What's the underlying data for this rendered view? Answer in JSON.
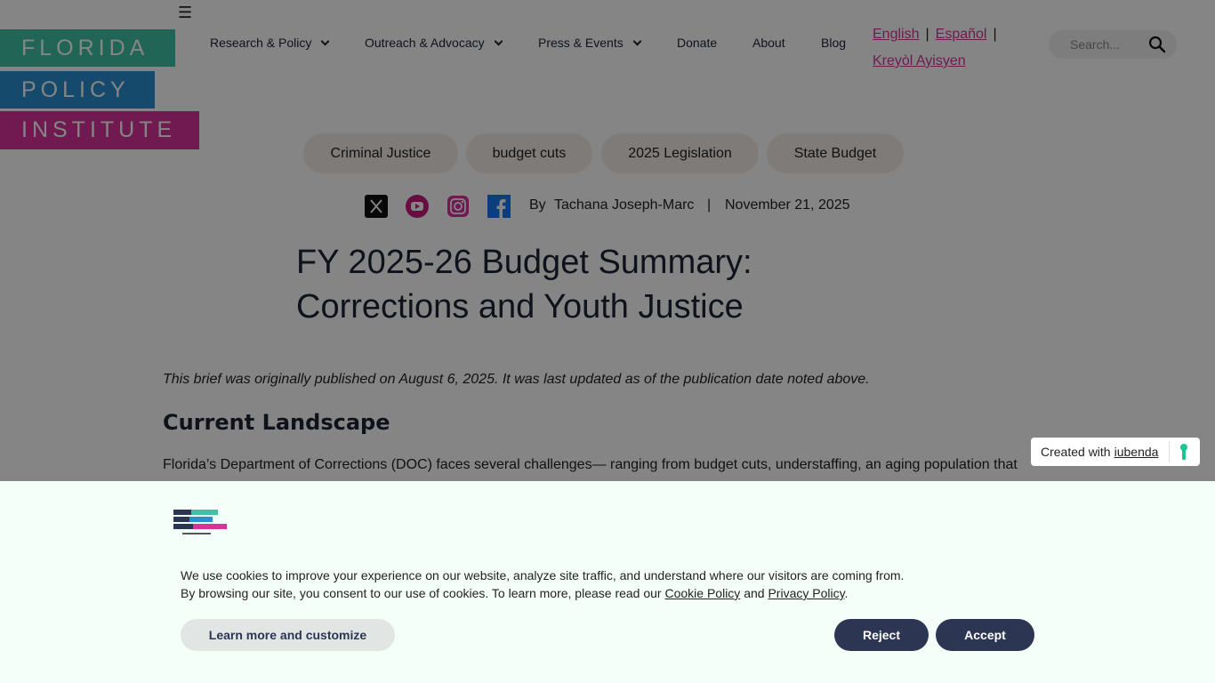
{
  "header": {
    "menu_glyph": "☰",
    "logo": [
      "FLORIDA",
      "POLICY",
      "INSTITUTE"
    ],
    "nav": [
      {
        "label": "Research & Policy",
        "dropdown": true
      },
      {
        "label": "Outreach & Advocacy",
        "dropdown": true
      },
      {
        "label": "Press & Events",
        "dropdown": true
      },
      {
        "label": "Donate",
        "dropdown": false
      },
      {
        "label": "About",
        "dropdown": false
      },
      {
        "label": "Blog",
        "dropdown": false
      }
    ],
    "languages": [
      "English",
      "Español",
      "Kreyòl Ayisyen"
    ],
    "search_placeholder": "Search..."
  },
  "article": {
    "tags": [
      "Criminal Justice",
      "budget cuts",
      "2025 Legislation",
      "State Budget"
    ],
    "social_icons": [
      "x-icon",
      "youtube-icon",
      "instagram-icon",
      "facebook-icon"
    ],
    "by": "By",
    "author": "Tachana Joseph-Marc",
    "separator": "|",
    "date": "November 21, 2025",
    "title_line1": "FY 2025-26 Budget Summary:",
    "title_line2": "Corrections and Youth Justice",
    "brief_note": "This brief was originally published on August 6, 2025. It was last updated as of the publication date noted above.",
    "section_heading": "Current Landscape",
    "paragraph_start": "Florida’s Department of Corrections (DOC) faces several challenges— ranging from budget cuts, understaffing, an aging population that"
  },
  "iubenda": {
    "prefix": "Created with",
    "link": "iubenda"
  },
  "cookie_banner": {
    "line1": "We use cookies to improve your experience on our website, analyze site traffic, and understand where our visitors are coming from.",
    "line2_prefix": "By browsing our site, you consent to our use of cookies. To learn more, please read our",
    "cookie_policy_link": "Cookie Policy",
    "and": "and",
    "privacy_policy_link": "Privacy Policy",
    "period": ".",
    "learn_more_label": "Learn more and customize",
    "reject_label": "Reject",
    "accept_label": "Accept"
  },
  "colors": {
    "teal": "#3fc1a5",
    "blue": "#2a8fd0",
    "magenta": "#d6339b",
    "navy": "#2c3652"
  }
}
